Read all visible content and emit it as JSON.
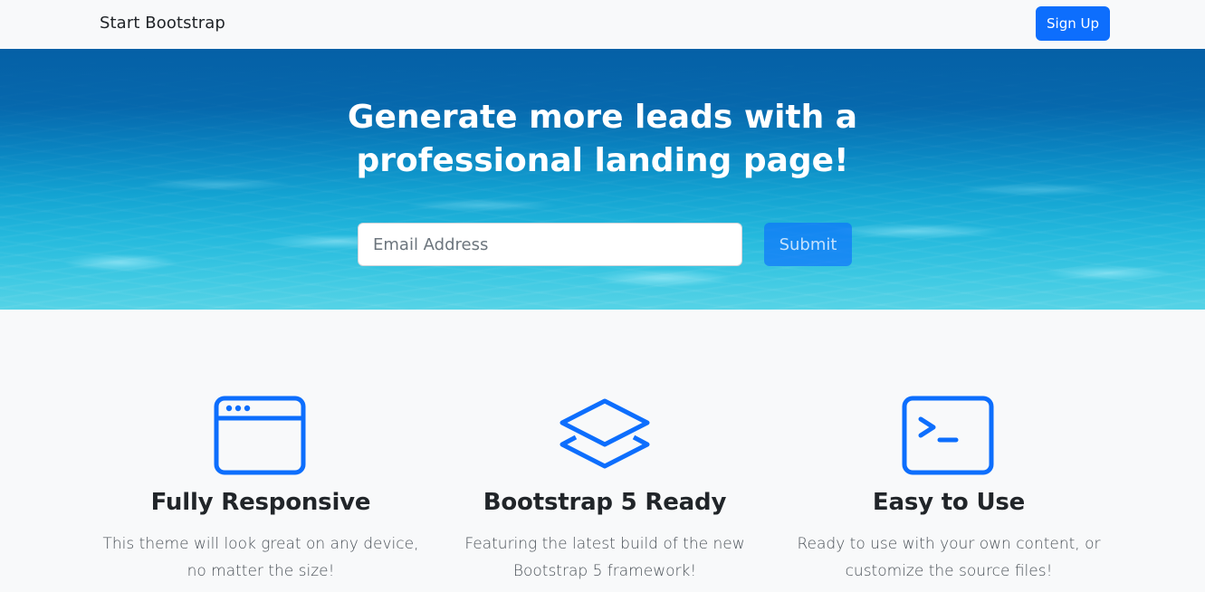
{
  "nav": {
    "brand": "Start Bootstrap",
    "signup_label": "Sign Up"
  },
  "masthead": {
    "headline_line1": "Generate more leads with a",
    "headline_line2": "professional landing page!",
    "email_placeholder": "Email Address",
    "submit_label": "Submit"
  },
  "features": [
    {
      "icon": "window-icon",
      "title": "Fully Responsive",
      "text_line1": "This theme will look great on any device,",
      "text_line2": "no matter the size!"
    },
    {
      "icon": "layers-icon",
      "title": "Bootstrap 5 Ready",
      "text_line1": "Featuring the latest build of the new",
      "text_line2": "Bootstrap 5 framework!"
    },
    {
      "icon": "terminal-icon",
      "title": "Easy to Use",
      "text_line1": "Ready to use with your own content, or",
      "text_line2": "customize the source files!"
    }
  ],
  "colors": {
    "primary": "#0d6efd",
    "background": "#f8f9fa",
    "heading": "#212529"
  }
}
